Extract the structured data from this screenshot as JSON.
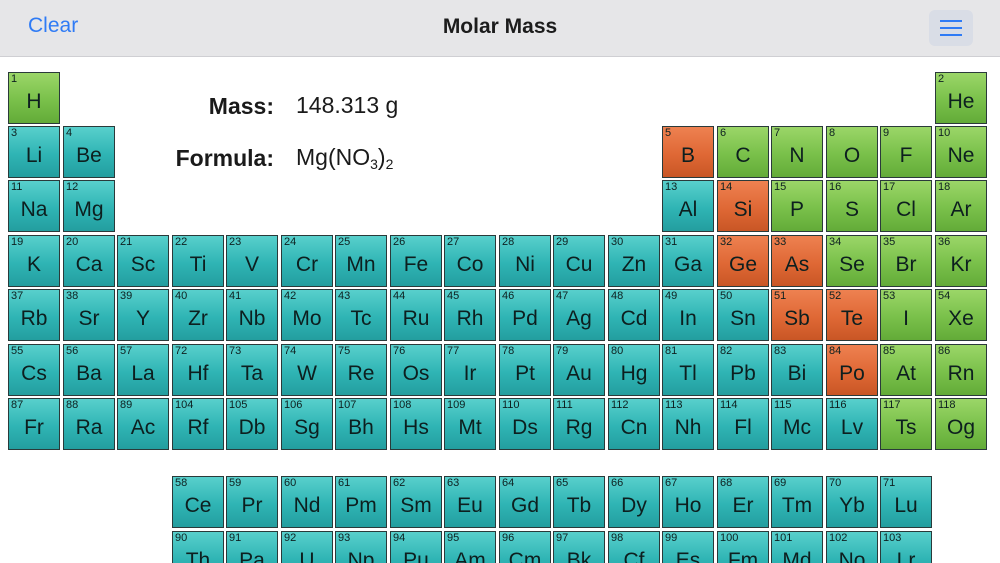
{
  "navbar": {
    "clear_label": "Clear",
    "title": "Molar Mass",
    "menu_icon": "hamburger-menu-icon"
  },
  "result": {
    "mass_label": "Mass:",
    "mass_value": "148.313 g",
    "formula_label": "Formula:",
    "formula_parts": [
      {
        "text": "Mg(NO",
        "sub": false
      },
      {
        "text": "3",
        "sub": true
      },
      {
        "text": ")",
        "sub": false
      },
      {
        "text": "2",
        "sub": true
      }
    ]
  },
  "colors": {
    "metal": "#2fb4b4",
    "nonmetal": "#79c04a",
    "metalloid": "#df6835",
    "accent": "#2f7bf5"
  },
  "elements": [
    {
      "n": 1,
      "s": "H",
      "r": 1,
      "c": 1,
      "t": "nonmetal"
    },
    {
      "n": 2,
      "s": "He",
      "r": 1,
      "c": 18,
      "t": "nonmetal"
    },
    {
      "n": 3,
      "s": "Li",
      "r": 2,
      "c": 1,
      "t": "metal"
    },
    {
      "n": 4,
      "s": "Be",
      "r": 2,
      "c": 2,
      "t": "metal"
    },
    {
      "n": 5,
      "s": "B",
      "r": 2,
      "c": 13,
      "t": "metalloid"
    },
    {
      "n": 6,
      "s": "C",
      "r": 2,
      "c": 14,
      "t": "nonmetal"
    },
    {
      "n": 7,
      "s": "N",
      "r": 2,
      "c": 15,
      "t": "nonmetal"
    },
    {
      "n": 8,
      "s": "O",
      "r": 2,
      "c": 16,
      "t": "nonmetal"
    },
    {
      "n": 9,
      "s": "F",
      "r": 2,
      "c": 17,
      "t": "nonmetal"
    },
    {
      "n": 10,
      "s": "Ne",
      "r": 2,
      "c": 18,
      "t": "nonmetal"
    },
    {
      "n": 11,
      "s": "Na",
      "r": 3,
      "c": 1,
      "t": "metal"
    },
    {
      "n": 12,
      "s": "Mg",
      "r": 3,
      "c": 2,
      "t": "metal"
    },
    {
      "n": 13,
      "s": "Al",
      "r": 3,
      "c": 13,
      "t": "metal"
    },
    {
      "n": 14,
      "s": "Si",
      "r": 3,
      "c": 14,
      "t": "metalloid"
    },
    {
      "n": 15,
      "s": "P",
      "r": 3,
      "c": 15,
      "t": "nonmetal"
    },
    {
      "n": 16,
      "s": "S",
      "r": 3,
      "c": 16,
      "t": "nonmetal"
    },
    {
      "n": 17,
      "s": "Cl",
      "r": 3,
      "c": 17,
      "t": "nonmetal"
    },
    {
      "n": 18,
      "s": "Ar",
      "r": 3,
      "c": 18,
      "t": "nonmetal"
    },
    {
      "n": 19,
      "s": "K",
      "r": 4,
      "c": 1,
      "t": "metal"
    },
    {
      "n": 20,
      "s": "Ca",
      "r": 4,
      "c": 2,
      "t": "metal"
    },
    {
      "n": 21,
      "s": "Sc",
      "r": 4,
      "c": 3,
      "t": "metal"
    },
    {
      "n": 22,
      "s": "Ti",
      "r": 4,
      "c": 4,
      "t": "metal"
    },
    {
      "n": 23,
      "s": "V",
      "r": 4,
      "c": 5,
      "t": "metal"
    },
    {
      "n": 24,
      "s": "Cr",
      "r": 4,
      "c": 6,
      "t": "metal"
    },
    {
      "n": 25,
      "s": "Mn",
      "r": 4,
      "c": 7,
      "t": "metal"
    },
    {
      "n": 26,
      "s": "Fe",
      "r": 4,
      "c": 8,
      "t": "metal"
    },
    {
      "n": 27,
      "s": "Co",
      "r": 4,
      "c": 9,
      "t": "metal"
    },
    {
      "n": 28,
      "s": "Ni",
      "r": 4,
      "c": 10,
      "t": "metal"
    },
    {
      "n": 29,
      "s": "Cu",
      "r": 4,
      "c": 11,
      "t": "metal"
    },
    {
      "n": 30,
      "s": "Zn",
      "r": 4,
      "c": 12,
      "t": "metal"
    },
    {
      "n": 31,
      "s": "Ga",
      "r": 4,
      "c": 13,
      "t": "metal"
    },
    {
      "n": 32,
      "s": "Ge",
      "r": 4,
      "c": 14,
      "t": "metalloid"
    },
    {
      "n": 33,
      "s": "As",
      "r": 4,
      "c": 15,
      "t": "metalloid"
    },
    {
      "n": 34,
      "s": "Se",
      "r": 4,
      "c": 16,
      "t": "nonmetal"
    },
    {
      "n": 35,
      "s": "Br",
      "r": 4,
      "c": 17,
      "t": "nonmetal"
    },
    {
      "n": 36,
      "s": "Kr",
      "r": 4,
      "c": 18,
      "t": "nonmetal"
    },
    {
      "n": 37,
      "s": "Rb",
      "r": 5,
      "c": 1,
      "t": "metal"
    },
    {
      "n": 38,
      "s": "Sr",
      "r": 5,
      "c": 2,
      "t": "metal"
    },
    {
      "n": 39,
      "s": "Y",
      "r": 5,
      "c": 3,
      "t": "metal"
    },
    {
      "n": 40,
      "s": "Zr",
      "r": 5,
      "c": 4,
      "t": "metal"
    },
    {
      "n": 41,
      "s": "Nb",
      "r": 5,
      "c": 5,
      "t": "metal"
    },
    {
      "n": 42,
      "s": "Mo",
      "r": 5,
      "c": 6,
      "t": "metal"
    },
    {
      "n": 43,
      "s": "Tc",
      "r": 5,
      "c": 7,
      "t": "metal"
    },
    {
      "n": 44,
      "s": "Ru",
      "r": 5,
      "c": 8,
      "t": "metal"
    },
    {
      "n": 45,
      "s": "Rh",
      "r": 5,
      "c": 9,
      "t": "metal"
    },
    {
      "n": 46,
      "s": "Pd",
      "r": 5,
      "c": 10,
      "t": "metal"
    },
    {
      "n": 47,
      "s": "Ag",
      "r": 5,
      "c": 11,
      "t": "metal"
    },
    {
      "n": 48,
      "s": "Cd",
      "r": 5,
      "c": 12,
      "t": "metal"
    },
    {
      "n": 49,
      "s": "In",
      "r": 5,
      "c": 13,
      "t": "metal"
    },
    {
      "n": 50,
      "s": "Sn",
      "r": 5,
      "c": 14,
      "t": "metal"
    },
    {
      "n": 51,
      "s": "Sb",
      "r": 5,
      "c": 15,
      "t": "metalloid"
    },
    {
      "n": 52,
      "s": "Te",
      "r": 5,
      "c": 16,
      "t": "metalloid"
    },
    {
      "n": 53,
      "s": "I",
      "r": 5,
      "c": 17,
      "t": "nonmetal"
    },
    {
      "n": 54,
      "s": "Xe",
      "r": 5,
      "c": 18,
      "t": "nonmetal"
    },
    {
      "n": 55,
      "s": "Cs",
      "r": 6,
      "c": 1,
      "t": "metal"
    },
    {
      "n": 56,
      "s": "Ba",
      "r": 6,
      "c": 2,
      "t": "metal"
    },
    {
      "n": 57,
      "s": "La",
      "r": 6,
      "c": 3,
      "t": "metal"
    },
    {
      "n": 72,
      "s": "Hf",
      "r": 6,
      "c": 4,
      "t": "metal"
    },
    {
      "n": 73,
      "s": "Ta",
      "r": 6,
      "c": 5,
      "t": "metal"
    },
    {
      "n": 74,
      "s": "W",
      "r": 6,
      "c": 6,
      "t": "metal"
    },
    {
      "n": 75,
      "s": "Re",
      "r": 6,
      "c": 7,
      "t": "metal"
    },
    {
      "n": 76,
      "s": "Os",
      "r": 6,
      "c": 8,
      "t": "metal"
    },
    {
      "n": 77,
      "s": "Ir",
      "r": 6,
      "c": 9,
      "t": "metal"
    },
    {
      "n": 78,
      "s": "Pt",
      "r": 6,
      "c": 10,
      "t": "metal"
    },
    {
      "n": 79,
      "s": "Au",
      "r": 6,
      "c": 11,
      "t": "metal"
    },
    {
      "n": 80,
      "s": "Hg",
      "r": 6,
      "c": 12,
      "t": "metal"
    },
    {
      "n": 81,
      "s": "Tl",
      "r": 6,
      "c": 13,
      "t": "metal"
    },
    {
      "n": 82,
      "s": "Pb",
      "r": 6,
      "c": 14,
      "t": "metal"
    },
    {
      "n": 83,
      "s": "Bi",
      "r": 6,
      "c": 15,
      "t": "metal"
    },
    {
      "n": 84,
      "s": "Po",
      "r": 6,
      "c": 16,
      "t": "metalloid"
    },
    {
      "n": 85,
      "s": "At",
      "r": 6,
      "c": 17,
      "t": "nonmetal"
    },
    {
      "n": 86,
      "s": "Rn",
      "r": 6,
      "c": 18,
      "t": "nonmetal"
    },
    {
      "n": 87,
      "s": "Fr",
      "r": 7,
      "c": 1,
      "t": "metal"
    },
    {
      "n": 88,
      "s": "Ra",
      "r": 7,
      "c": 2,
      "t": "metal"
    },
    {
      "n": 89,
      "s": "Ac",
      "r": 7,
      "c": 3,
      "t": "metal"
    },
    {
      "n": 104,
      "s": "Rf",
      "r": 7,
      "c": 4,
      "t": "metal"
    },
    {
      "n": 105,
      "s": "Db",
      "r": 7,
      "c": 5,
      "t": "metal"
    },
    {
      "n": 106,
      "s": "Sg",
      "r": 7,
      "c": 6,
      "t": "metal"
    },
    {
      "n": 107,
      "s": "Bh",
      "r": 7,
      "c": 7,
      "t": "metal"
    },
    {
      "n": 108,
      "s": "Hs",
      "r": 7,
      "c": 8,
      "t": "metal"
    },
    {
      "n": 109,
      "s": "Mt",
      "r": 7,
      "c": 9,
      "t": "metal"
    },
    {
      "n": 110,
      "s": "Ds",
      "r": 7,
      "c": 10,
      "t": "metal"
    },
    {
      "n": 111,
      "s": "Rg",
      "r": 7,
      "c": 11,
      "t": "metal"
    },
    {
      "n": 112,
      "s": "Cn",
      "r": 7,
      "c": 12,
      "t": "metal"
    },
    {
      "n": 113,
      "s": "Nh",
      "r": 7,
      "c": 13,
      "t": "metal"
    },
    {
      "n": 114,
      "s": "Fl",
      "r": 7,
      "c": 14,
      "t": "metal"
    },
    {
      "n": 115,
      "s": "Mc",
      "r": 7,
      "c": 15,
      "t": "metal"
    },
    {
      "n": 116,
      "s": "Lv",
      "r": 7,
      "c": 16,
      "t": "metal"
    },
    {
      "n": 117,
      "s": "Ts",
      "r": 7,
      "c": 17,
      "t": "nonmetal"
    },
    {
      "n": 118,
      "s": "Og",
      "r": 7,
      "c": 18,
      "t": "nonmetal"
    },
    {
      "n": 58,
      "s": "Ce",
      "r": 9,
      "c": 4,
      "t": "metal"
    },
    {
      "n": 59,
      "s": "Pr",
      "r": 9,
      "c": 5,
      "t": "metal"
    },
    {
      "n": 60,
      "s": "Nd",
      "r": 9,
      "c": 6,
      "t": "metal"
    },
    {
      "n": 61,
      "s": "Pm",
      "r": 9,
      "c": 7,
      "t": "metal"
    },
    {
      "n": 62,
      "s": "Sm",
      "r": 9,
      "c": 8,
      "t": "metal"
    },
    {
      "n": 63,
      "s": "Eu",
      "r": 9,
      "c": 9,
      "t": "metal"
    },
    {
      "n": 64,
      "s": "Gd",
      "r": 9,
      "c": 10,
      "t": "metal"
    },
    {
      "n": 65,
      "s": "Tb",
      "r": 9,
      "c": 11,
      "t": "metal"
    },
    {
      "n": 66,
      "s": "Dy",
      "r": 9,
      "c": 12,
      "t": "metal"
    },
    {
      "n": 67,
      "s": "Ho",
      "r": 9,
      "c": 13,
      "t": "metal"
    },
    {
      "n": 68,
      "s": "Er",
      "r": 9,
      "c": 14,
      "t": "metal"
    },
    {
      "n": 69,
      "s": "Tm",
      "r": 9,
      "c": 15,
      "t": "metal"
    },
    {
      "n": 70,
      "s": "Yb",
      "r": 9,
      "c": 16,
      "t": "metal"
    },
    {
      "n": 71,
      "s": "Lu",
      "r": 9,
      "c": 17,
      "t": "metal"
    },
    {
      "n": 90,
      "s": "Th",
      "r": 10,
      "c": 4,
      "t": "metal"
    },
    {
      "n": 91,
      "s": "Pa",
      "r": 10,
      "c": 5,
      "t": "metal"
    },
    {
      "n": 92,
      "s": "U",
      "r": 10,
      "c": 6,
      "t": "metal"
    },
    {
      "n": 93,
      "s": "Np",
      "r": 10,
      "c": 7,
      "t": "metal"
    },
    {
      "n": 94,
      "s": "Pu",
      "r": 10,
      "c": 8,
      "t": "metal"
    },
    {
      "n": 95,
      "s": "Am",
      "r": 10,
      "c": 9,
      "t": "metal"
    },
    {
      "n": 96,
      "s": "Cm",
      "r": 10,
      "c": 10,
      "t": "metal"
    },
    {
      "n": 97,
      "s": "Bk",
      "r": 10,
      "c": 11,
      "t": "metal"
    },
    {
      "n": 98,
      "s": "Cf",
      "r": 10,
      "c": 12,
      "t": "metal"
    },
    {
      "n": 99,
      "s": "Es",
      "r": 10,
      "c": 13,
      "t": "metal"
    },
    {
      "n": 100,
      "s": "Fm",
      "r": 10,
      "c": 14,
      "t": "metal"
    },
    {
      "n": 101,
      "s": "Md",
      "r": 10,
      "c": 15,
      "t": "metal"
    },
    {
      "n": 102,
      "s": "No",
      "r": 10,
      "c": 16,
      "t": "metal"
    },
    {
      "n": 103,
      "s": "Lr",
      "r": 10,
      "c": 17,
      "t": "metal"
    }
  ]
}
